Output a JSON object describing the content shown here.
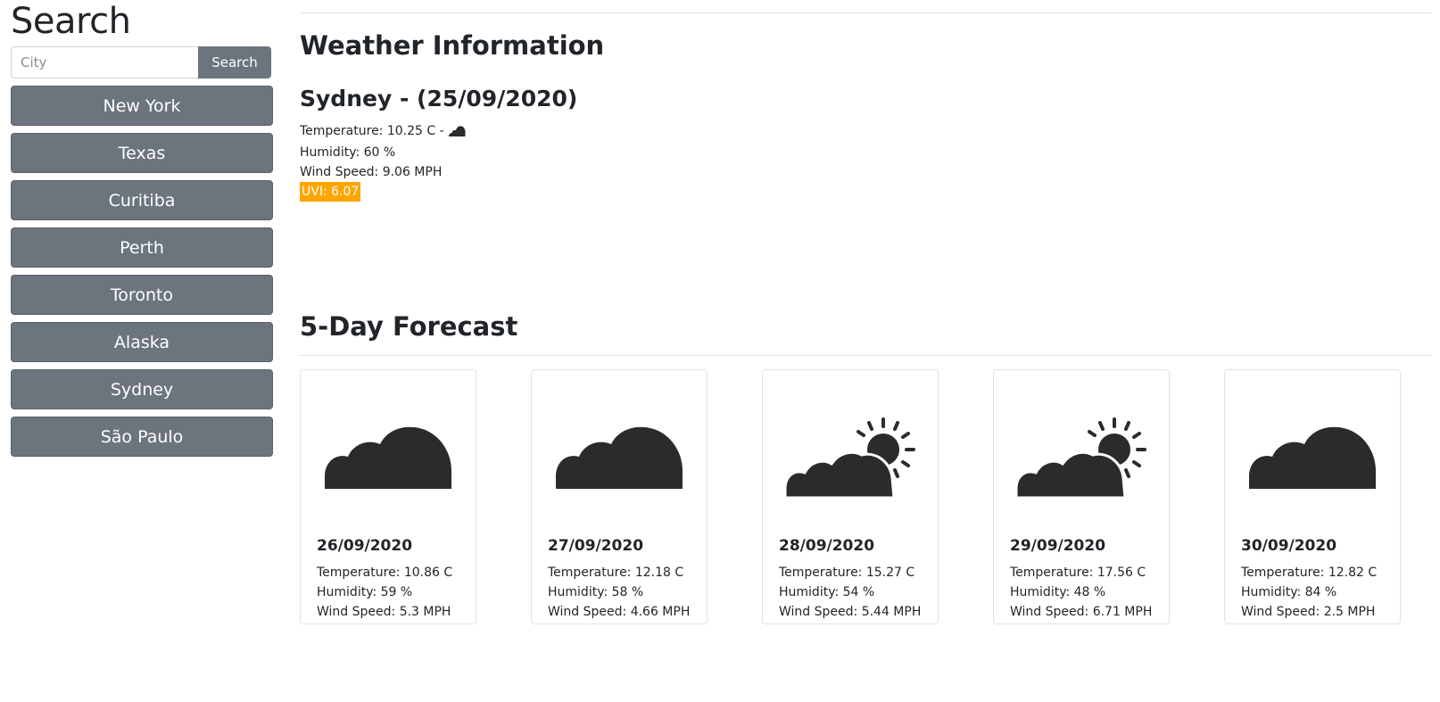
{
  "sidebar": {
    "title": "Search",
    "search_placeholder": "City",
    "search_button": "Search",
    "cities": [
      "New York",
      "Texas",
      "Curitiba",
      "Perth",
      "Toronto",
      "Alaska",
      "Sydney",
      "São Paulo"
    ]
  },
  "weather": {
    "heading": "Weather Information",
    "city_date": "Sydney - (25/09/2020)",
    "temperature": "Temperature: 10.25 C - ",
    "icon": "cloud-icon",
    "humidity": "Humidity: 60 %",
    "wind": "Wind Speed: 9.06 MPH",
    "uvi": "UVI: 6.07",
    "uvi_color": "#ffa500"
  },
  "forecast": {
    "heading": "5-Day Forecast",
    "days": [
      {
        "icon": "cloud-icon",
        "date": "26/09/2020",
        "temperature": "Temperature: 10.86 C",
        "humidity": "Humidity: 59 %",
        "wind": "Wind Speed: 5.3 MPH"
      },
      {
        "icon": "cloud-icon",
        "date": "27/09/2020",
        "temperature": "Temperature: 12.18 C",
        "humidity": "Humidity: 58 %",
        "wind": "Wind Speed: 4.66 MPH"
      },
      {
        "icon": "partly-sunny-icon",
        "date": "28/09/2020",
        "temperature": "Temperature: 15.27 C",
        "humidity": "Humidity: 54 %",
        "wind": "Wind Speed: 5.44 MPH"
      },
      {
        "icon": "partly-sunny-icon",
        "date": "29/09/2020",
        "temperature": "Temperature: 17.56 C",
        "humidity": "Humidity: 48 %",
        "wind": "Wind Speed: 6.71 MPH"
      },
      {
        "icon": "cloud-icon",
        "date": "30/09/2020",
        "temperature": "Temperature: 12.82 C",
        "humidity": "Humidity: 84 %",
        "wind": "Wind Speed: 2.5 MPH"
      }
    ]
  }
}
